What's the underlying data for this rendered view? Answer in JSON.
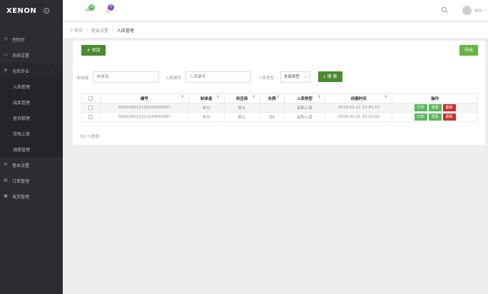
{
  "app": {
    "logo": "XENON"
  },
  "sidebar": {
    "items": [
      {
        "label": "控制台",
        "icon": "dashboard-icon",
        "has_children": false
      },
      {
        "label": "系统设置",
        "icon": "monitor-icon",
        "has_children": true
      },
      {
        "label": "仓库作业",
        "icon": "gear-icon",
        "has_children": true,
        "open": true
      }
    ],
    "submenu": [
      "入库管理",
      "出库管理",
      "查询管理",
      "货物上架",
      "调度管理"
    ],
    "items_after": [
      {
        "label": "基本设置",
        "icon": "gear-icon",
        "has_children": true
      },
      {
        "label": "订单管理",
        "icon": "order-icon",
        "has_children": true
      },
      {
        "label": "发货管理",
        "icon": "truck-icon",
        "has_children": true
      }
    ]
  },
  "topbar": {
    "messages_badge": "15",
    "alerts_badge": "7",
    "username": "布尔"
  },
  "breadcrumb": {
    "home": "首页",
    "level1": "基本设置",
    "current": "入库管理"
  },
  "toolbar": {
    "add_label": "添加",
    "export_label": "导出",
    "search_label": "搜 索"
  },
  "filters": {
    "creator_label": "制单者",
    "creator_placeholder": "制单者",
    "number_label": "入库编号",
    "number_placeholder": "入库编号",
    "type_label": "入库类型",
    "type_value": "全部类型"
  },
  "table": {
    "headers": [
      "编号",
      "制单者",
      "供应商",
      "车牌",
      "入库类型",
      "创建时间",
      "操作"
    ],
    "rows": [
      [
        "SN201801211041482690?",
        "布尔",
        "默认",
        "",
        "采购入库",
        "2018-01-21 22:41:57"
      ],
      [
        "SN201801211121404256?",
        "布尔",
        "默认",
        "苏E",
        "采购入库",
        "2018-01-21 23:22:02"
      ]
    ],
    "actions": [
      "打印",
      "查看",
      "删除"
    ],
    "total_text": "共2 行数据"
  },
  "colors": {
    "sidebar_bg": "#2b2d31",
    "primary_green": "#4b8b2f",
    "light_green": "#64b640",
    "danger_red": "#c9302c"
  }
}
